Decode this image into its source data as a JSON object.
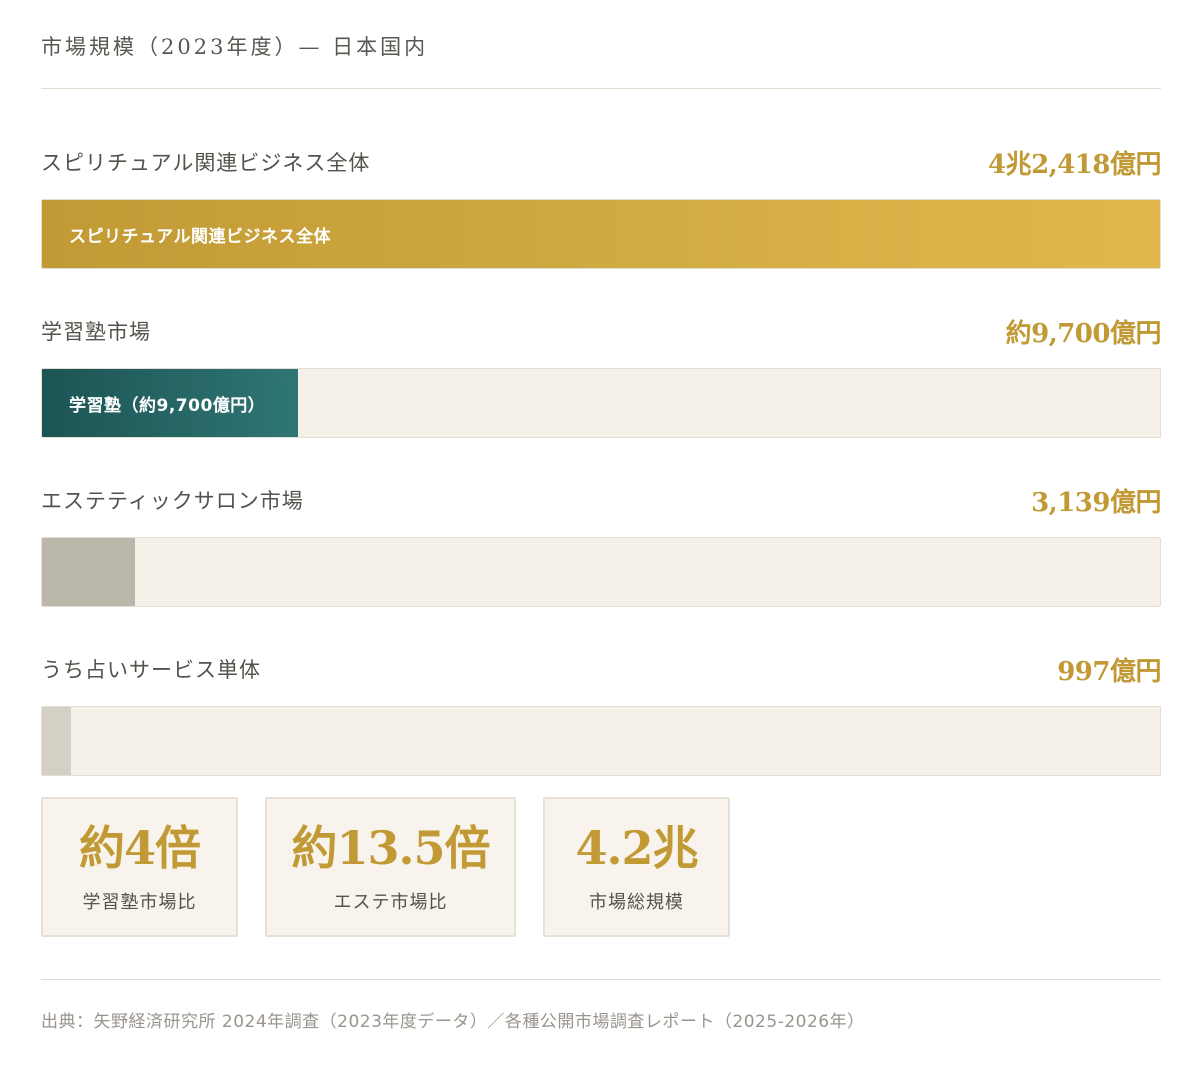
{
  "header": {
    "title": "市場規模（2023年度）— 日本国内"
  },
  "colors": {
    "accent_gold": "#c19a35",
    "gold_bar_start": "#c19a35",
    "gold_bar_end": "#e0b84d",
    "teal_bar_start": "#1c5454",
    "teal_bar_end": "#2f7674",
    "gray_bar": "#bbb7ab",
    "light_gray_bar": "#d4d0c6",
    "track": "#f5f0e8"
  },
  "chart_data": {
    "type": "bar",
    "orientation": "horizontal",
    "unit": "億円",
    "categories": [
      "スピリチュアル関連ビジネス全体",
      "学習塾市場",
      "エステティックサロン市場",
      "うち占いサービス単体"
    ],
    "values": [
      42418,
      9700,
      3139,
      997
    ],
    "value_labels": [
      "4兆2,418億円",
      "約9,700億円",
      "3,139億円",
      "997億円"
    ],
    "bar_labels": [
      "スピリチュアル関連ビジネス全体",
      "学習塾（約9,700億円）",
      "",
      ""
    ],
    "bar_styles": [
      "gold",
      "teal",
      "gray",
      "light-gray"
    ],
    "xlim": [
      0,
      42418
    ]
  },
  "stats": [
    {
      "value": "約4倍",
      "label": "学習塾市場比"
    },
    {
      "value": "約13.5倍",
      "label": "エステ市場比"
    },
    {
      "value": "4.2兆",
      "label": "市場総規模"
    }
  ],
  "footer": {
    "source": "出典：矢野経済研究所 2024年調査（2023年度データ）／各種公開市場調査レポート（2025-2026年）"
  }
}
